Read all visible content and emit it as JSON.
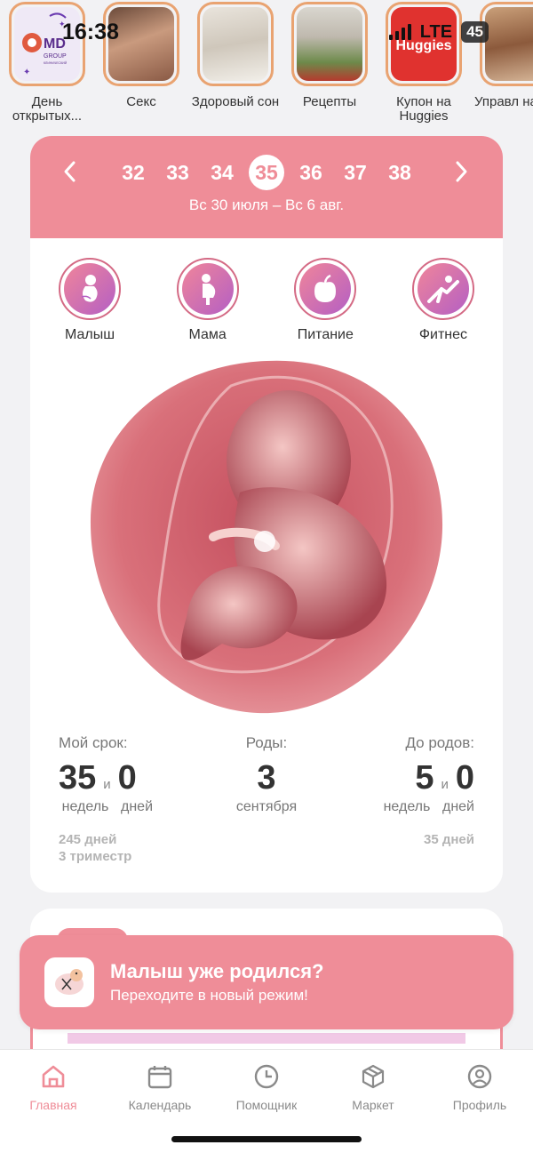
{
  "status_bar": {
    "time": "16:38",
    "network": "LTE",
    "battery": "45"
  },
  "stories": [
    {
      "label": "День открытых...",
      "logo_text": "MD GROUP",
      "logo_sub": "КЛИНИЧЕСКИЙ ГОСПИТАЛЬ"
    },
    {
      "label": "Секс"
    },
    {
      "label": "Здоровый сон"
    },
    {
      "label": "Рецепты"
    },
    {
      "label": "Купон на Huggies",
      "logo_text": "Huggies"
    },
    {
      "label": "Управл настро"
    }
  ],
  "weeks": {
    "numbers": [
      "32",
      "33",
      "34",
      "35",
      "36",
      "37",
      "38"
    ],
    "selected": "35",
    "date_range": "Вс 30 июля – Вс 6 авг."
  },
  "categories": [
    {
      "label": "Малыш",
      "icon": "baby-icon"
    },
    {
      "label": "Мама",
      "icon": "pregnant-woman-icon"
    },
    {
      "label": "Питание",
      "icon": "apple-icon"
    },
    {
      "label": "Фитнес",
      "icon": "fitness-icon"
    }
  ],
  "stats": {
    "term": {
      "title": "Мой срок:",
      "weeks": "35",
      "conj": "и",
      "days": "0",
      "weeks_unit": "недель",
      "days_unit": "дней",
      "total_days": "245 дней",
      "trimester": "3 триместр"
    },
    "birth": {
      "title": "Роды:",
      "day": "3",
      "month": "сентября"
    },
    "left": {
      "title": "До родов:",
      "weeks": "5",
      "conj": "и",
      "days": "0",
      "weeks_unit": "недель",
      "days_unit": "дней",
      "total_days": "35 дней"
    }
  },
  "banner": {
    "title": "Малыш уже родился?",
    "subtitle": "Переходите в новый режим!"
  },
  "tabbar": [
    {
      "label": "Главная",
      "icon": "home-icon",
      "active": true
    },
    {
      "label": "Календарь",
      "icon": "calendar-icon"
    },
    {
      "label": "Помощник",
      "icon": "clock-icon"
    },
    {
      "label": "Маркет",
      "icon": "box-icon"
    },
    {
      "label": "Профиль",
      "icon": "profile-icon"
    }
  ],
  "colors": {
    "accent": "#ef8d98",
    "story_ring": "#e9a371",
    "category_gradient_start": "#f0859a",
    "category_gradient_end": "#b45fc4"
  }
}
